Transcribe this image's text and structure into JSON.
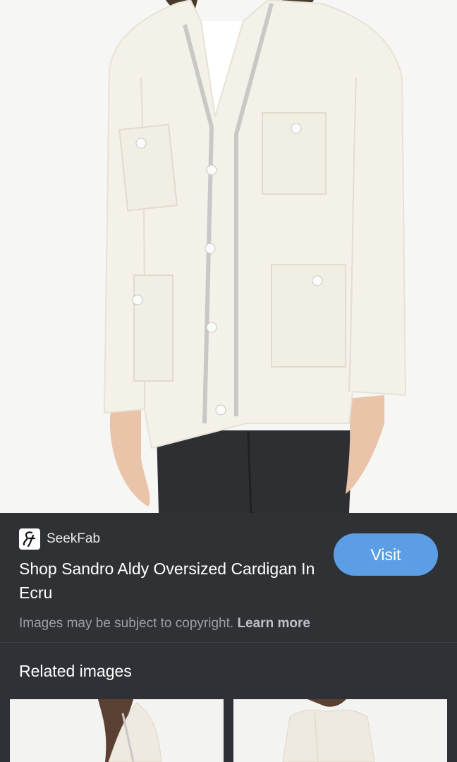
{
  "source": {
    "logo_text": "SF",
    "name": "SeekFab",
    "icon": "seekfab-logo-icon"
  },
  "result": {
    "title": "Shop Sandro Aldy Oversized Cardigan In Ecru",
    "visit_label": "Visit"
  },
  "notice": {
    "text": "Images may be subject to copyright.",
    "link": "Learn more"
  },
  "related": {
    "heading": "Related images"
  },
  "colors": {
    "panel_bg": "#303134",
    "visit_button": "#5b9ee6",
    "cardigan": "#f4f1e8"
  }
}
